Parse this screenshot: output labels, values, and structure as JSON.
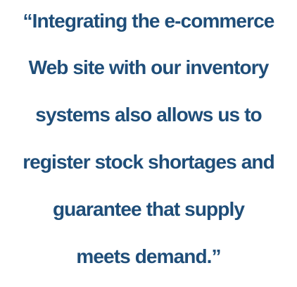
{
  "quote": {
    "lines": [
      "“Integrating the e-commerce",
      "Web site with our inventory",
      "systems also allows us to",
      "register stock shortages and",
      "guarantee that supply",
      "meets demand.”"
    ],
    "text_color": "#1f4e79"
  }
}
